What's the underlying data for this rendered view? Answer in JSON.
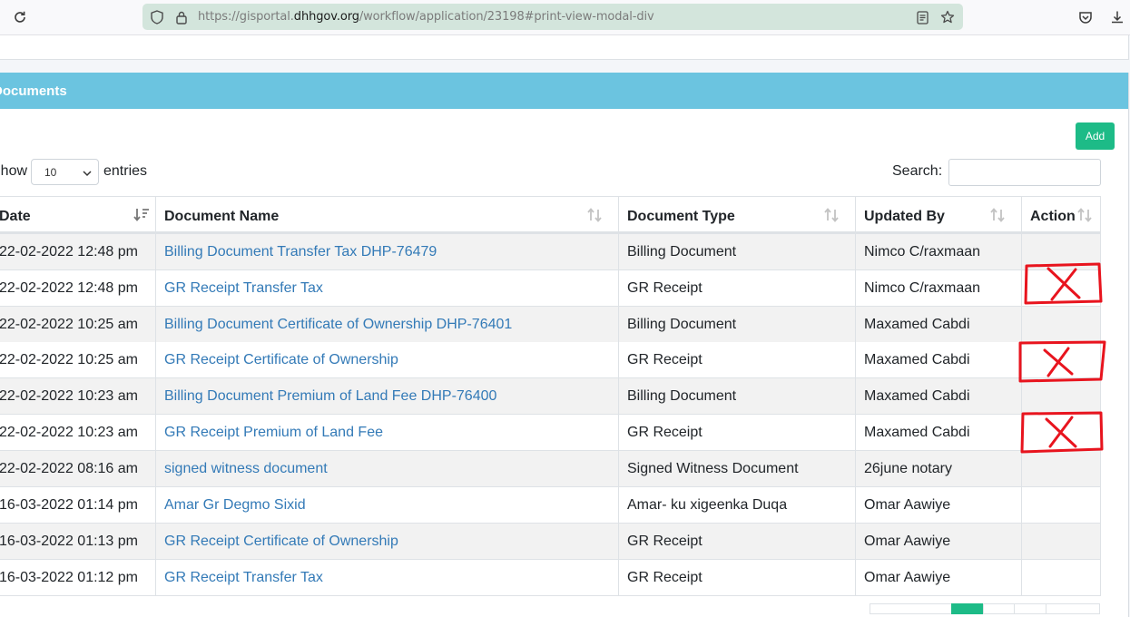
{
  "browser": {
    "url_prefix": "https://gisportal.",
    "url_domain": "dhhgov.org",
    "url_path": "/workflow/application/23198#print-view-modal-div"
  },
  "card": {
    "title": "Documents",
    "add_label": "Add",
    "show_label": "Show",
    "entries_value": "10",
    "entries_label": "entries",
    "search_label": "Search:",
    "search_value": ""
  },
  "table": {
    "headers": [
      "Date",
      "Document Name",
      "Document Type",
      "Updated By",
      "Action"
    ],
    "rows": [
      {
        "date": "22-02-2022 12:48 pm",
        "name": "Billing Document Transfer Tax DHP-76479",
        "type": "Billing Document",
        "by": "Nimco C/raxmaan",
        "action": ""
      },
      {
        "date": "22-02-2022 12:48 pm",
        "name": "GR Receipt Transfer Tax",
        "type": "GR Receipt",
        "by": "Nimco C/raxmaan",
        "action": ""
      },
      {
        "date": "22-02-2022 10:25 am",
        "name": "Billing Document Certificate of Ownership DHP-76401",
        "type": "Billing Document",
        "by": "Maxamed Cabdi",
        "action": ""
      },
      {
        "date": "22-02-2022 10:25 am",
        "name": "GR Receipt Certificate of Ownership",
        "type": "GR Receipt",
        "by": "Maxamed Cabdi",
        "action": ""
      },
      {
        "date": "22-02-2022 10:23 am",
        "name": "Billing Document Premium of Land Fee DHP-76400",
        "type": "Billing Document",
        "by": "Maxamed Cabdi",
        "action": ""
      },
      {
        "date": "22-02-2022 10:23 am",
        "name": "GR Receipt Premium of Land Fee",
        "type": "GR Receipt",
        "by": "Maxamed Cabdi",
        "action": ""
      },
      {
        "date": "22-02-2022 08:16 am",
        "name": "signed witness document",
        "type": "Signed Witness Document",
        "by": "26june notary",
        "action": ""
      },
      {
        "date": "16-03-2022 01:14 pm",
        "name": "Amar Gr Degmo Sixid",
        "type": "Amar- ku xigeenka Duqa",
        "by": "Omar Aawiye",
        "action": ""
      },
      {
        "date": "16-03-2022 01:13 pm",
        "name": "GR Receipt Certificate of Ownership",
        "type": "GR Receipt",
        "by": "Omar Aawiye",
        "action": ""
      },
      {
        "date": "16-03-2022 01:12 pm",
        "name": "GR Receipt Transfer Tax",
        "type": "GR Receipt",
        "by": "Omar Aawiye",
        "action": ""
      }
    ]
  },
  "annotations": {
    "marked_rows": [
      1,
      3,
      5
    ],
    "color": "#e8141e"
  },
  "colors": {
    "header_bg": "#6bc4e0",
    "add_button": "#1dbb87",
    "link": "#337ab7",
    "url_bar": "#d3e5dc",
    "pager_active": "#1dbb87"
  },
  "icons": [
    "reload-icon",
    "shield-icon",
    "lock-icon",
    "reader-view-icon",
    "bookmark-star-icon",
    "pocket-icon",
    "download-icon",
    "chevron-down-icon",
    "sort-desc-icon",
    "sort-both-icon"
  ]
}
